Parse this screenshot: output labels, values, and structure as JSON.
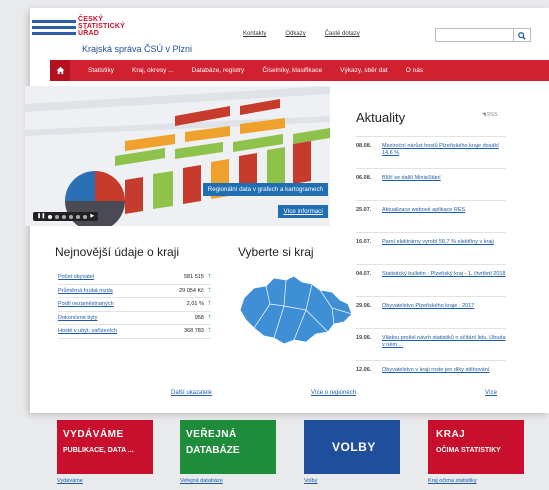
{
  "header": {
    "logo_line1": "ČESKÝ",
    "logo_line2": "STATISTICKÝ",
    "logo_line3": "ÚŘAD",
    "subtitle": "Krajská správa ČSÚ v Plzni",
    "links": [
      "Kontakty",
      "Odkazy",
      "Časté dotazy"
    ],
    "search_placeholder": "",
    "search_icon": "search-icon"
  },
  "nav": {
    "home_icon": "home-icon",
    "items": [
      "Statistiky",
      "Kraj, okresy ...",
      "Databáze, registry",
      "Číselníky, klasifikace",
      "Výkazy, sběr dat",
      "O nás"
    ]
  },
  "hero": {
    "caption": "Regionální data v grafech a kartogramech",
    "more": "Více informací"
  },
  "news": {
    "title": "Aktuality",
    "rss": "RSS",
    "items": [
      {
        "date": "08.08.",
        "text": "Meziroční nárůst hostů Plzeňského kraje dosáhl 14,6 %"
      },
      {
        "date": "06.08.",
        "text": "Blíží se další MiniaStání"
      },
      {
        "date": "25.07.",
        "text": "Aktualizace webové aplikace RES"
      },
      {
        "date": "16.07.",
        "text": "Parní elektrárny vyrobí 58,7 % elektřiny v kraji"
      },
      {
        "date": "04.07.",
        "text": "Statistický bulletin - Plzeňský kraj - 1. čtvrtletí 2018"
      },
      {
        "date": "29.06.",
        "text": "Obyvatelstvo Plzeňského kraje - 2017"
      },
      {
        "date": "19.06.",
        "text": "Vládou prošel návrh statistiků o sčítání lidu. Úbuda v ném ..."
      },
      {
        "date": "12.06.",
        "text": "Obyvatelstvo v kraji roste jen díky stěhování"
      }
    ],
    "more": "Více"
  },
  "stats": {
    "title": "Nejnovější údaje o kraji",
    "rows": [
      {
        "name": "Počet obyvatel",
        "value": "581 515"
      },
      {
        "name": "Průměrná hrubá mzda",
        "value": "29 054 Kč"
      },
      {
        "name": "Podíl nezaměstnaných",
        "value": "2,01 %"
      },
      {
        "name": "Dokončené byty",
        "value": "958"
      },
      {
        "name": "Hosté v ubyt. zařízeních",
        "value": "368 783"
      }
    ],
    "more": "Další ukazatele"
  },
  "map": {
    "title": "Vyberte si kraj",
    "more": "Více o regionech"
  },
  "promos": [
    {
      "line1": "VYDÁVÁME",
      "line2": "PUBLIKACE, DATA ...",
      "link": "Vydáváme",
      "color": "#c8102e"
    },
    {
      "line1": "VEŘEJNÁ",
      "line2": "DATABÁZE",
      "link": "Veřejná databáze",
      "color": "#1e8c3a"
    },
    {
      "line1": "VOLBY",
      "line2": "",
      "link": "Volby",
      "color": "#1f4f9c"
    },
    {
      "line1": "KRAJ",
      "line2": "OČIMA STATISTIKY",
      "link": "Kraj očima statistiky",
      "color": "#c8102e"
    }
  ]
}
